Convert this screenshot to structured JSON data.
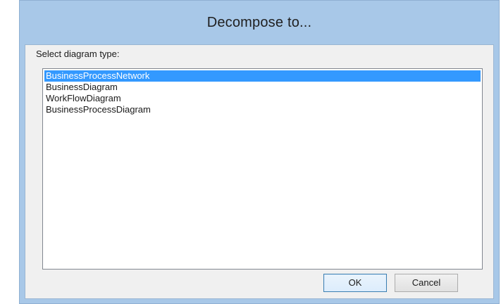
{
  "dialog": {
    "title": "Decompose to...",
    "prompt": "Select diagram type:",
    "items": [
      {
        "label": "BusinessProcessNetwork",
        "selected": true
      },
      {
        "label": "BusinessDiagram",
        "selected": false
      },
      {
        "label": "WorkFlowDiagram",
        "selected": false
      },
      {
        "label": "BusinessProcessDiagram",
        "selected": false
      }
    ],
    "ok_label": "OK",
    "cancel_label": "Cancel"
  },
  "colors": {
    "titlebar": "#a8c8e8",
    "selection": "#3399ff",
    "client_bg": "#f0f0f0"
  }
}
